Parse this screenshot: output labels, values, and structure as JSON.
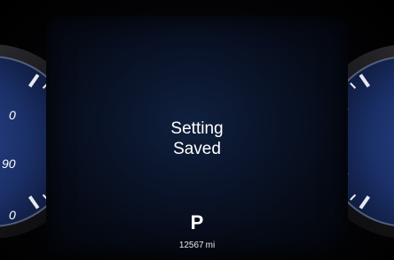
{
  "display": {
    "message_line1": "Setting",
    "message_line2": "Saved",
    "gear": "P",
    "odometer_value": "12567",
    "odometer_unit": "mi"
  },
  "gauges": {
    "left_visible_labels": [
      "0",
      "90",
      "0"
    ]
  },
  "colors": {
    "gauge_face": "#1a2f66",
    "display_glow": "#10203e",
    "text": "#ffffff",
    "needle_ticks": "#e6e9ef"
  }
}
